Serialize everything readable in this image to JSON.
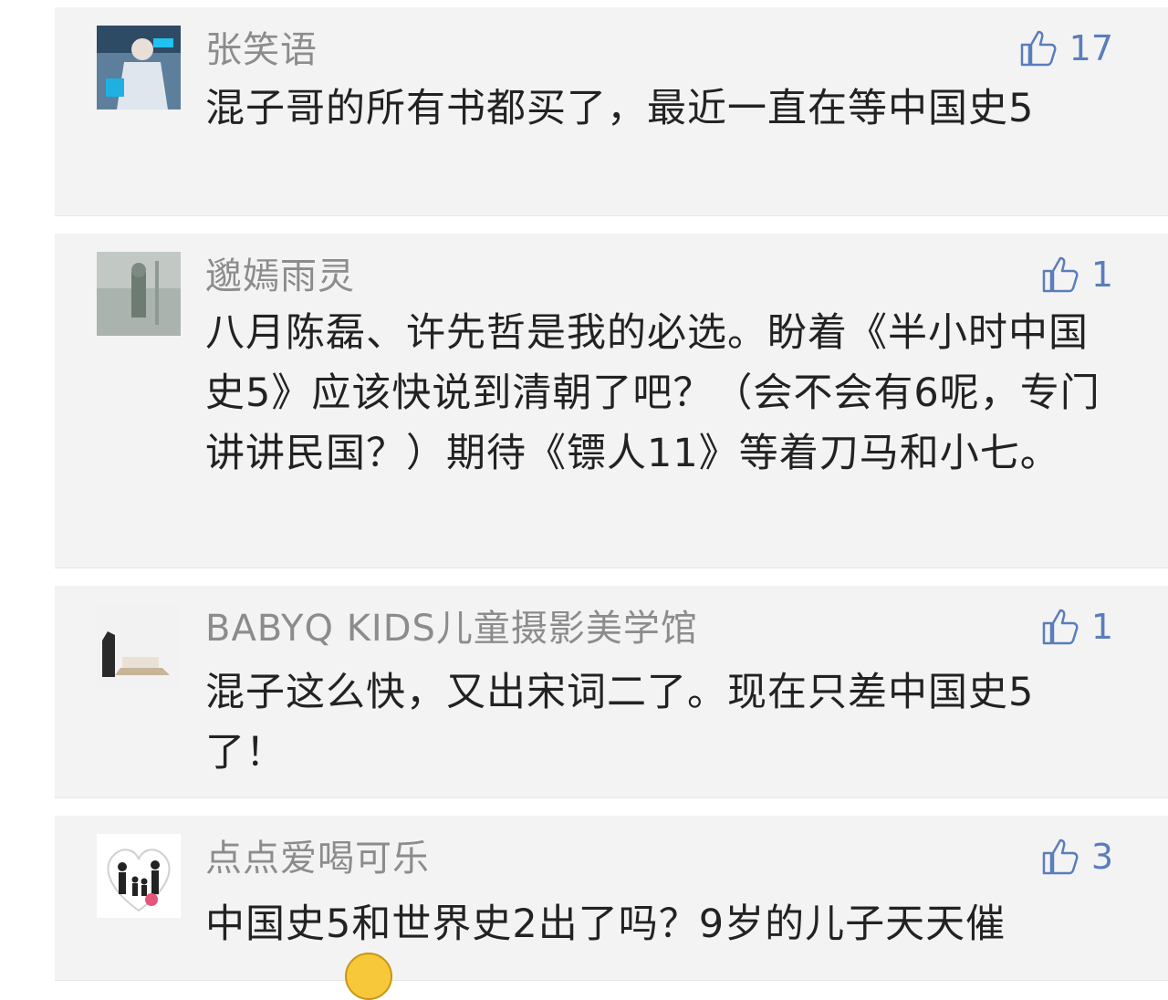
{
  "comments": [
    {
      "name": "张笑语",
      "likes": "17",
      "text": "混子哥的所有书都买了，最近一直在等中国史5",
      "avatar_icon": "anime-character-avatar"
    },
    {
      "name": "邈嫣雨灵",
      "likes": "1",
      "text": "八月陈磊、许先哲是我的必选。盼着《半小时中国史5》应该快说到清朝了吧？（会不会有6呢，专门讲讲民国？）期待《镖人11》等着刀马和小七。",
      "avatar_icon": "gray-photo-avatar"
    },
    {
      "name": "BABYQ KIDS儿童摄影美学馆",
      "likes": "1",
      "text": "混子这么快，又出宋词二了。现在只差中国史5了！",
      "avatar_icon": "wooden-horse-avatar"
    },
    {
      "name": "点点爱喝可乐",
      "likes": "3",
      "text": "中国史5和世界史2出了吗？9岁的儿子天天催",
      "avatar_icon": "family-heart-avatar"
    }
  ],
  "icons": {
    "like": "thumbs-up-icon"
  },
  "colors": {
    "card_bg": "#f3f3f3",
    "name": "#8c8c8c",
    "like": "#5a7dbd",
    "text": "#222222"
  }
}
